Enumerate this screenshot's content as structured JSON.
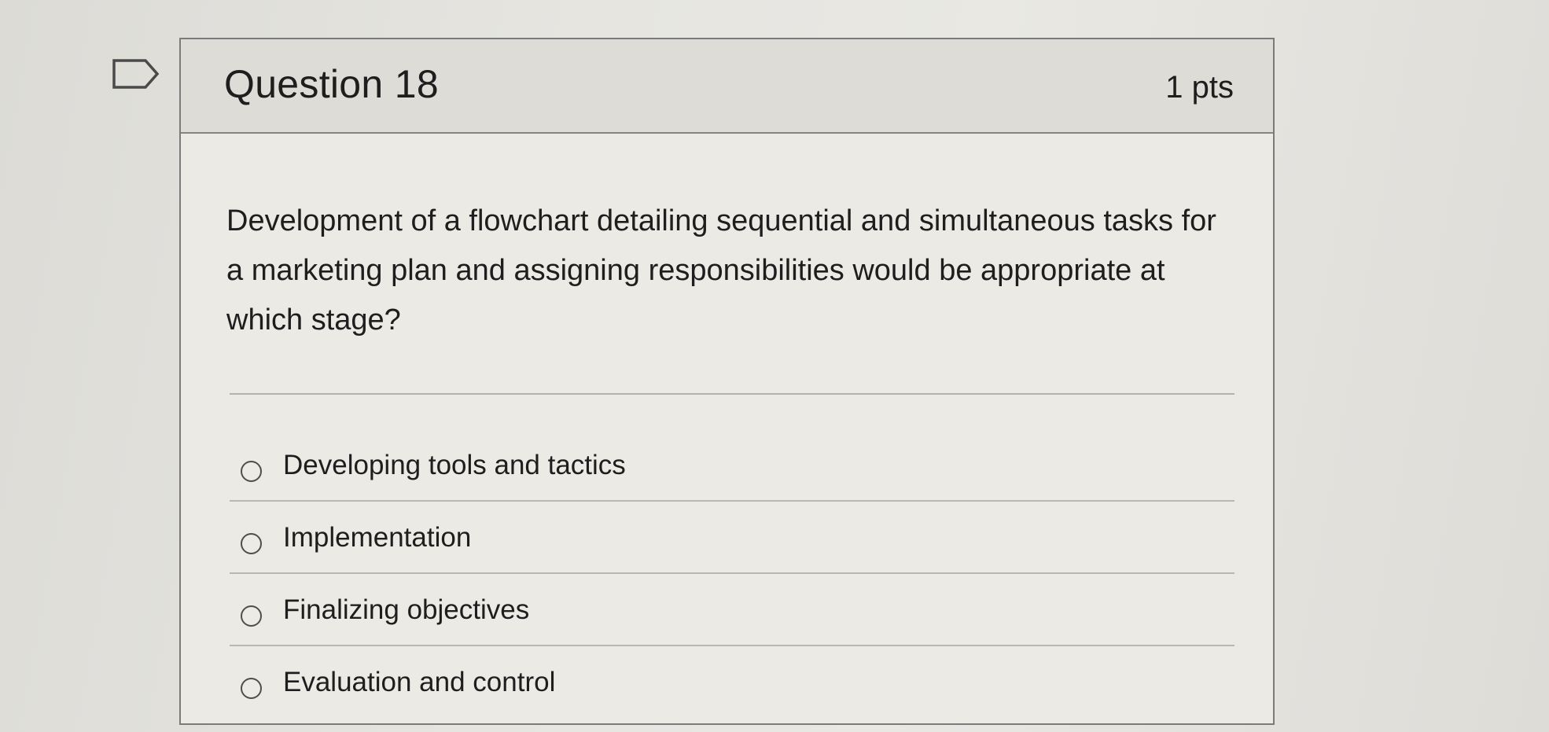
{
  "question": {
    "title": "Question 18",
    "points": "1 pts",
    "text": "Development of a flowchart detailing sequential and simultaneous tasks for a marketing plan and assigning responsibilities would be appropriate at which stage?",
    "answers": [
      {
        "label": "Developing tools and tactics",
        "selected": false
      },
      {
        "label": "Implementation",
        "selected": false
      },
      {
        "label": "Finalizing objectives",
        "selected": false
      },
      {
        "label": "Evaluation and control",
        "selected": false
      }
    ]
  },
  "icons": {
    "flag": "flag-question-icon"
  },
  "colors": {
    "header_bg": "#dddcd7",
    "card_bg": "#eceae5",
    "border": "#7b7b7b",
    "text": "#1e1e1e"
  }
}
